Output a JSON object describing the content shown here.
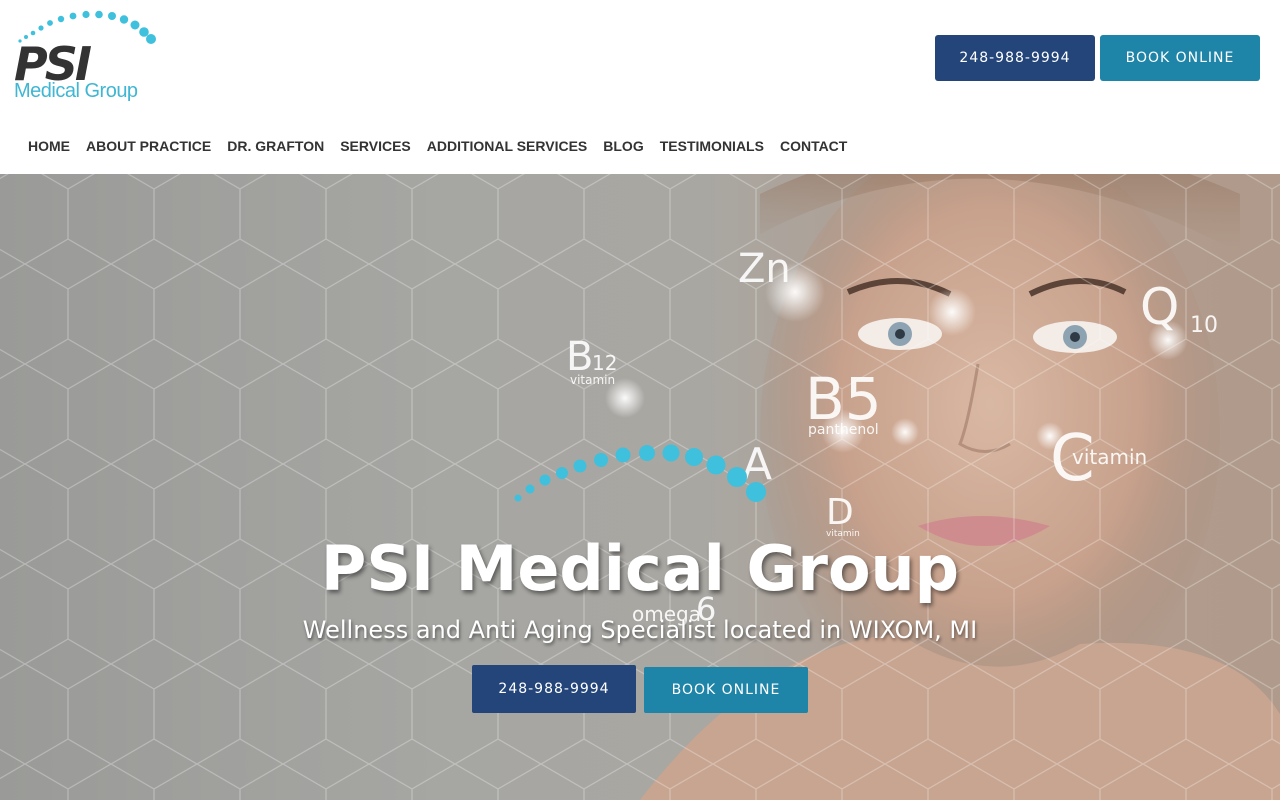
{
  "brand": {
    "logo_text": "PSI",
    "logo_subtext": "Medical Group",
    "logo_color": "#3fb6d3",
    "logo_dark": "#333333"
  },
  "header": {
    "phone_label": "248-988-9994",
    "book_label": "BOOK ONLINE"
  },
  "nav": {
    "items": [
      {
        "label": "HOME"
      },
      {
        "label": "ABOUT PRACTICE"
      },
      {
        "label": "DR. GRAFTON"
      },
      {
        "label": "SERVICES"
      },
      {
        "label": "ADDITIONAL SERVICES"
      },
      {
        "label": "BLOG"
      },
      {
        "label": "TESTIMONIALS"
      },
      {
        "label": "CONTACT"
      }
    ]
  },
  "hero": {
    "title": "PSI Medical Group",
    "subtitle": "Wellness and Anti Aging Specialist located in WIXOM, MI",
    "phone_label": "248-988-9994",
    "book_label": "BOOK ONLINE",
    "vitamin_labels": {
      "zn": "Zn",
      "q": "Q",
      "q_sub": "10",
      "b12": "B",
      "b12_sub": "12",
      "b12_word": "vitamin",
      "b5": "B5",
      "b5_word": "panthenol",
      "a": "A",
      "d": "D",
      "d_word": "vitamin",
      "c": "C",
      "c_word": "vitamin",
      "omega": "omega",
      "omega_num": "6"
    }
  },
  "colors": {
    "primary_dark": "#23457a",
    "primary_teal": "#1e84a8",
    "accent_dots": "#3fc0dc"
  }
}
